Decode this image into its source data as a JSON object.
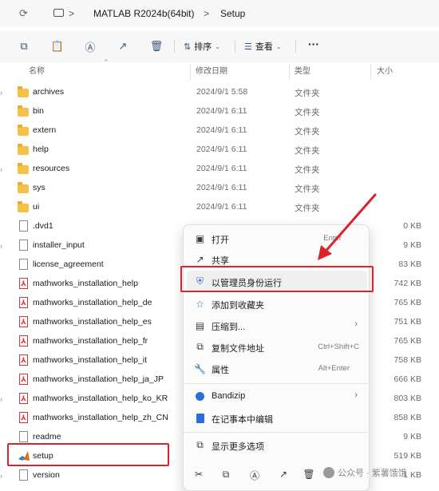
{
  "breadcrumb": {
    "items": [
      "MATLAB R2024b(64bit)",
      "Setup"
    ],
    "separator": ">"
  },
  "toolbar": {
    "sort_label": "排序",
    "view_label": "查看",
    "more_label": "···"
  },
  "columns": {
    "name": "名称",
    "modified": "修改日期",
    "type": "类型",
    "size": "大小"
  },
  "files": [
    {
      "name": "archives",
      "date": "2024/9/1 5:58",
      "type": "文件夹",
      "size": "",
      "kind": "folder"
    },
    {
      "name": "bin",
      "date": "2024/9/1 6:11",
      "type": "文件夹",
      "size": "",
      "kind": "folder"
    },
    {
      "name": "extern",
      "date": "2024/9/1 6:11",
      "type": "文件夹",
      "size": "",
      "kind": "folder"
    },
    {
      "name": "help",
      "date": "2024/9/1 6:11",
      "type": "文件夹",
      "size": "",
      "kind": "folder"
    },
    {
      "name": "resources",
      "date": "2024/9/1 6:11",
      "type": "文件夹",
      "size": "",
      "kind": "folder"
    },
    {
      "name": "sys",
      "date": "2024/9/1 6:11",
      "type": "文件夹",
      "size": "",
      "kind": "folder"
    },
    {
      "name": "ui",
      "date": "2024/9/1 6:11",
      "type": "文件夹",
      "size": "",
      "kind": "folder"
    },
    {
      "name": ".dvd1",
      "date": "",
      "type": "",
      "size": "0 KB",
      "kind": "doc"
    },
    {
      "name": "installer_input",
      "date": "",
      "type": "",
      "size": "9 KB",
      "kind": "doc"
    },
    {
      "name": "license_agreement",
      "date": "",
      "type": "",
      "size": "83 KB",
      "kind": "doc"
    },
    {
      "name": "mathworks_installation_help",
      "date": "",
      "type": "",
      "size": "742 KB",
      "kind": "pdf"
    },
    {
      "name": "mathworks_installation_help_de",
      "date": "",
      "type": "",
      "size": "765 KB",
      "kind": "pdf"
    },
    {
      "name": "mathworks_installation_help_es",
      "date": "",
      "type": "",
      "size": "751 KB",
      "kind": "pdf"
    },
    {
      "name": "mathworks_installation_help_fr",
      "date": "",
      "type": "",
      "size": "765 KB",
      "kind": "pdf"
    },
    {
      "name": "mathworks_installation_help_it",
      "date": "",
      "type": "",
      "size": "758 KB",
      "kind": "pdf"
    },
    {
      "name": "mathworks_installation_help_ja_JP",
      "date": "",
      "type": "",
      "size": "666 KB",
      "kind": "pdf"
    },
    {
      "name": "mathworks_installation_help_ko_KR",
      "date": "",
      "type": "",
      "size": "803 KB",
      "kind": "pdf"
    },
    {
      "name": "mathworks_installation_help_zh_CN",
      "date": "",
      "type": "",
      "size": "858 KB",
      "kind": "pdf"
    },
    {
      "name": "readme",
      "date": "",
      "type": "",
      "size": "9 KB",
      "kind": "doc"
    },
    {
      "name": "setup",
      "date": "",
      "type": "",
      "size": "519 KB",
      "kind": "matlab"
    },
    {
      "name": "version",
      "date": "",
      "type": "",
      "size": "1 KB",
      "kind": "doc"
    }
  ],
  "context_menu": {
    "open": {
      "label": "打开",
      "shortcut": "Enter"
    },
    "share": {
      "label": "共享"
    },
    "run_as_admin": {
      "label": "以管理员身份运行"
    },
    "add_favorites": {
      "label": "添加到收藏夹"
    },
    "compress": {
      "label": "压缩到..."
    },
    "copy_path": {
      "label": "复制文件地址",
      "shortcut": "Ctrl+Shift+C"
    },
    "properties": {
      "label": "属性",
      "shortcut": "Alt+Enter"
    },
    "bandizip": {
      "label": "Bandizip"
    },
    "notepad": {
      "label": "在记事本中编辑"
    },
    "more_options": {
      "label": "显示更多选项"
    }
  },
  "watermark": "公众号 · 紫薯饿饿",
  "colors": {
    "highlight_box": "#d9232d",
    "arrow": "#d9232d",
    "folder": "#f4c24a"
  }
}
